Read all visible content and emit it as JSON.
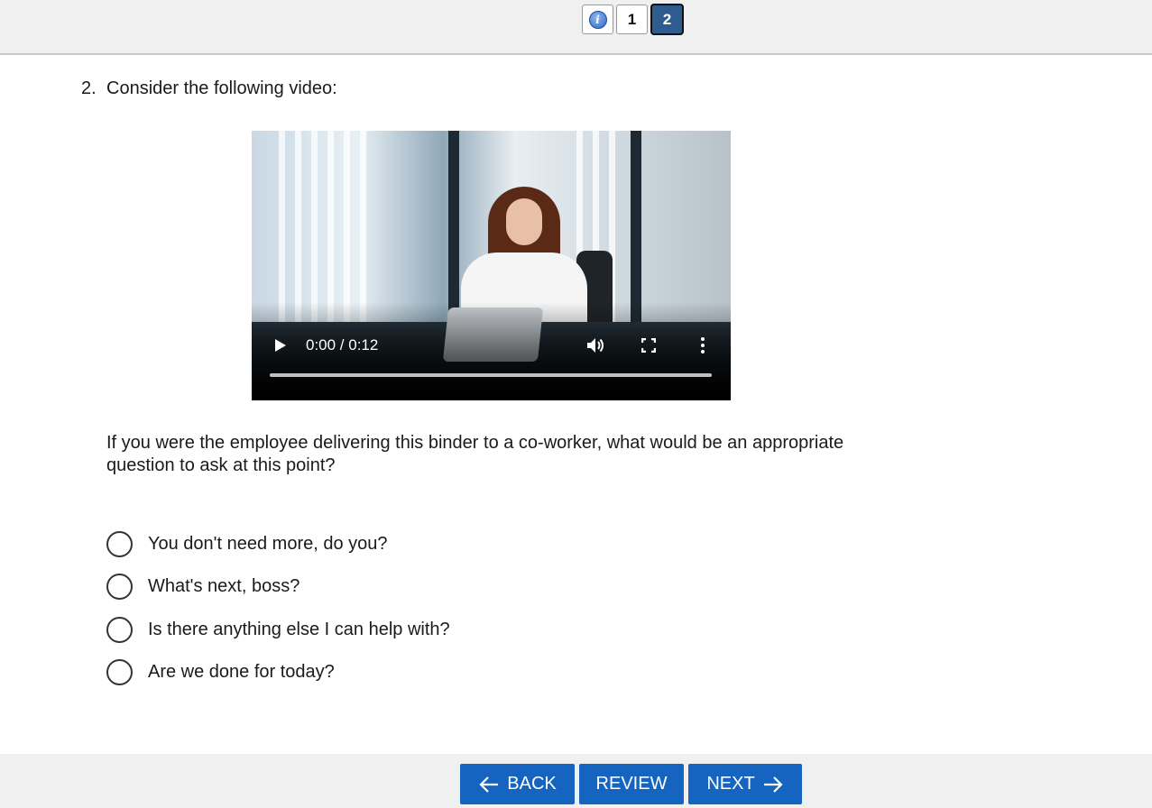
{
  "pager": {
    "info_label": "i",
    "pages": [
      "1",
      "2"
    ],
    "current": "2"
  },
  "question": {
    "number": "2.",
    "prompt": "Consider the following video:",
    "text": "If you were the employee delivering this binder to a co-worker, what would be an appropriate question to ask at this point?"
  },
  "video": {
    "time": "0:00 / 0:12",
    "progress": 0
  },
  "options": [
    "You don't need more, do you?",
    "What's next, boss?",
    "Is there anything else I can help with?",
    "Are we done for today?"
  ],
  "footer": {
    "back_label": "BACK",
    "review_label": "REVIEW",
    "next_label": "NEXT"
  },
  "colors": {
    "accent": "#1565c0",
    "active_page": "#2e5c8e"
  }
}
